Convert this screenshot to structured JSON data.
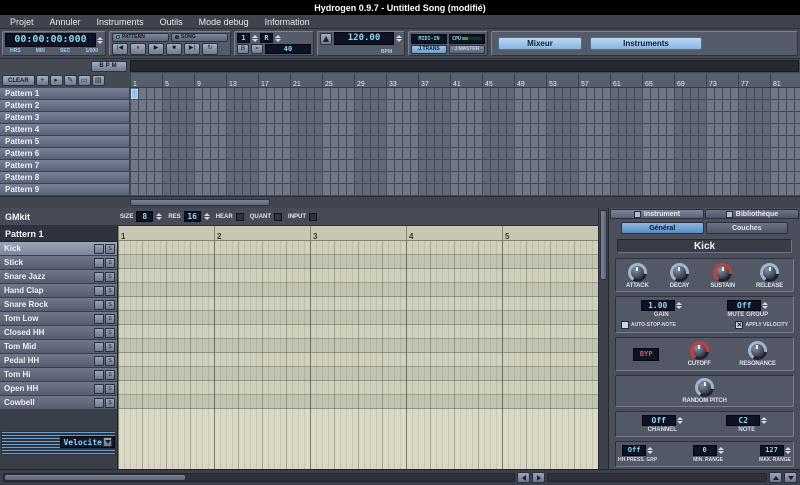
{
  "window": {
    "title": "Hydrogen 0.9.7 - Untitled Song (modifié)"
  },
  "menu": {
    "items": [
      "Projet",
      "Annuler",
      "Instruments",
      "Outils",
      "Mode debug",
      "Information"
    ]
  },
  "toolbar": {
    "time": {
      "value": "00:00:00:000",
      "unit_labels": [
        "HRS",
        "MIN",
        "SEC",
        "1/000"
      ]
    },
    "transport": {
      "rewind_icon": "|◀",
      "record_icon": "●",
      "play_icon": "▶",
      "stop_icon": "■",
      "forward_icon": "▶|",
      "loop_icon": "↻",
      "pattern_mode_label": "PATTERN",
      "song_mode_label": "SONG"
    },
    "beat_counter": {
      "display": "1",
      "rule": "R",
      "b_label": "B",
      "set_label": "=",
      "tempo": "40"
    },
    "bpm": {
      "value": "120.00",
      "label": "BPM"
    },
    "status": {
      "midi_in_label": "MIDI-IN",
      "cpu_label": "CPU",
      "jack_transport_label": "J.TRANS",
      "jack_master_label": "J.MASTER"
    },
    "windows": {
      "mixer_label": "Mixeur",
      "instruments_label": "Instruments"
    }
  },
  "song_editor": {
    "bpm_button_label": "BPM",
    "clear_button_label": "CLEAR",
    "tool_icons": {
      "add": "+",
      "pointer": "▸",
      "draw": "✎",
      "select": "▭",
      "stack": "▤"
    },
    "timeline_numbers": [
      "1",
      "5",
      "9",
      "13",
      "17",
      "21",
      "25",
      "29",
      "33",
      "37",
      "41",
      "45",
      "49",
      "53",
      "57",
      "61",
      "65",
      "69",
      "73",
      "77",
      "81"
    ],
    "patterns": [
      "Pattern 1",
      "Pattern 2",
      "Pattern 3",
      "Pattern 4",
      "Pattern 5",
      "Pattern 6",
      "Pattern 7",
      "Pattern 8",
      "Pattern 9"
    ],
    "active_cell": {
      "pattern": "Pattern 1",
      "column": 1
    }
  },
  "pattern_editor": {
    "drumkit_name": "GMkit",
    "pattern_name": "Pattern 1",
    "size_label": "SIZE",
    "size_value": "8",
    "res_label": "RES",
    "res_value": "16",
    "hear_label": "HEAR",
    "quant_label": "QUANT",
    "input_label": "INPUT",
    "ruler_numbers": [
      "1",
      "2",
      "3",
      "4",
      "5"
    ],
    "mute_label": "M",
    "solo_label": "S",
    "instruments": [
      "Kick",
      "Stick",
      "Snare Jazz",
      "Hand Clap",
      "Snare Rock",
      "Tom Low",
      "Closed HH",
      "Tom Mid",
      "Pedal HH",
      "Tom Hi",
      "Open HH",
      "Cowbell"
    ],
    "velocity_label": "Velocite"
  },
  "instrument_panel": {
    "tabs": {
      "instrument": "Instrument",
      "library": "Bibliothèque"
    },
    "sub_tabs": {
      "general": "Général",
      "layers": "Couches"
    },
    "instrument_name": "Kick",
    "envelope_knobs": [
      "ATTACK",
      "DECAY",
      "SUSTAIN",
      "RELEASE"
    ],
    "gain": {
      "value": "1.00",
      "label": "GAIN"
    },
    "mute_group": {
      "value": "Off",
      "label": "MUTE GROUP"
    },
    "checkboxes": [
      {
        "label": "AUTO-STOP-NOTE",
        "mark": ""
      },
      {
        "label": "APPLY VELOCITY",
        "mark": "✕"
      }
    ],
    "filter": {
      "bypass_label": "BYP",
      "cutoff_label": "CUTOFF",
      "resonance_label": "RESONANCE"
    },
    "random_pitch_label": "RANDOM PITCH",
    "midi": {
      "channel_value": "Off",
      "channel_label": "CHANNEL",
      "note_value": "C2",
      "note_label": "NOTE"
    },
    "ranges": [
      {
        "value": "Off",
        "label": "HH PRESS. GRP"
      },
      {
        "value": "0",
        "label": "MIN. RANGE"
      },
      {
        "value": "127",
        "label": "MAX. RANGE"
      }
    ]
  },
  "colors": {
    "accent_blue": "#9fc6ec",
    "lcd_text": "#8fd6f4",
    "lcd_bg": "#0d1322",
    "active_cell": "#93c3f0",
    "grid_paper": "#d9d9c5",
    "record_red": "#b82c2c"
  }
}
